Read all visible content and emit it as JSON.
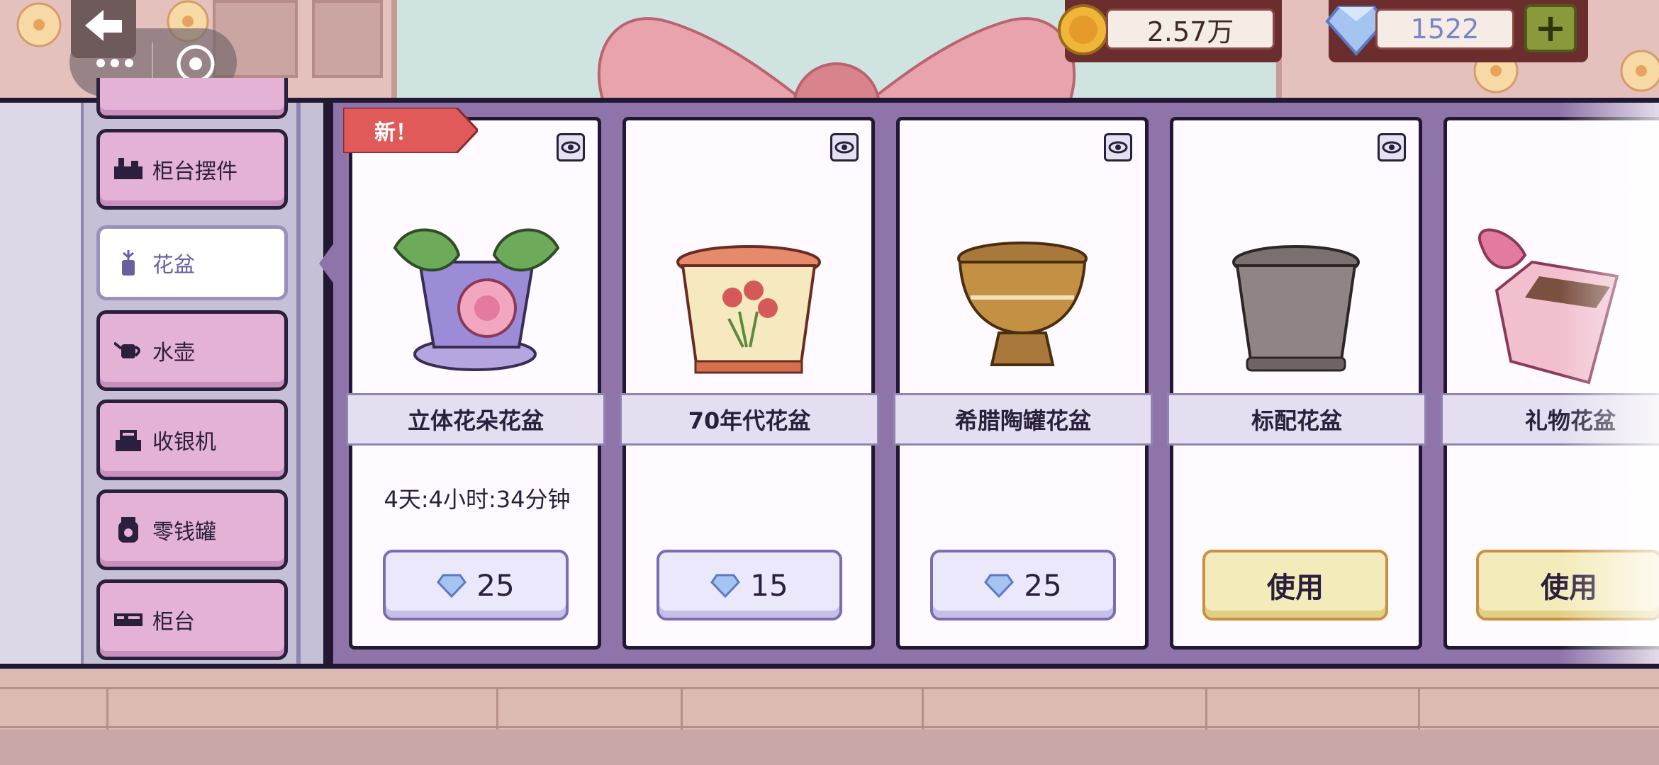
{
  "currency": {
    "coins": "2.57万",
    "gems": "1522",
    "add_label": "+"
  },
  "categories": [
    {
      "label": "柜台摆件",
      "icon": "counter-decor-icon",
      "active": false
    },
    {
      "label": "花盆",
      "icon": "flowerpot-icon",
      "active": true
    },
    {
      "label": "水壶",
      "icon": "watering-can-icon",
      "active": false
    },
    {
      "label": "收银机",
      "icon": "cash-register-icon",
      "active": false
    },
    {
      "label": "零钱罐",
      "icon": "coin-jar-icon",
      "active": false
    },
    {
      "label": "柜台",
      "icon": "counter-icon",
      "active": false
    }
  ],
  "items": [
    {
      "name": "立体花朵花盆",
      "badge": "新！",
      "timer": "4天:4小时:34分钟",
      "price": "25",
      "action": null
    },
    {
      "name": "70年代花盆",
      "badge": null,
      "timer": null,
      "price": "15",
      "action": null
    },
    {
      "name": "希腊陶罐花盆",
      "badge": null,
      "timer": null,
      "price": "25",
      "action": null
    },
    {
      "name": "标配花盆",
      "badge": null,
      "timer": null,
      "price": null,
      "action": "使用"
    },
    {
      "name": "礼物花盆",
      "badge": null,
      "timer": null,
      "price": null,
      "action": "使用"
    }
  ],
  "colors": {
    "panel_border": "#211933",
    "card_area": "#8f74aa",
    "category_item": "#e4b2d6",
    "price_button": "#ece8fb",
    "use_button": "#f4ebba",
    "badge_red": "#e05a5a"
  }
}
